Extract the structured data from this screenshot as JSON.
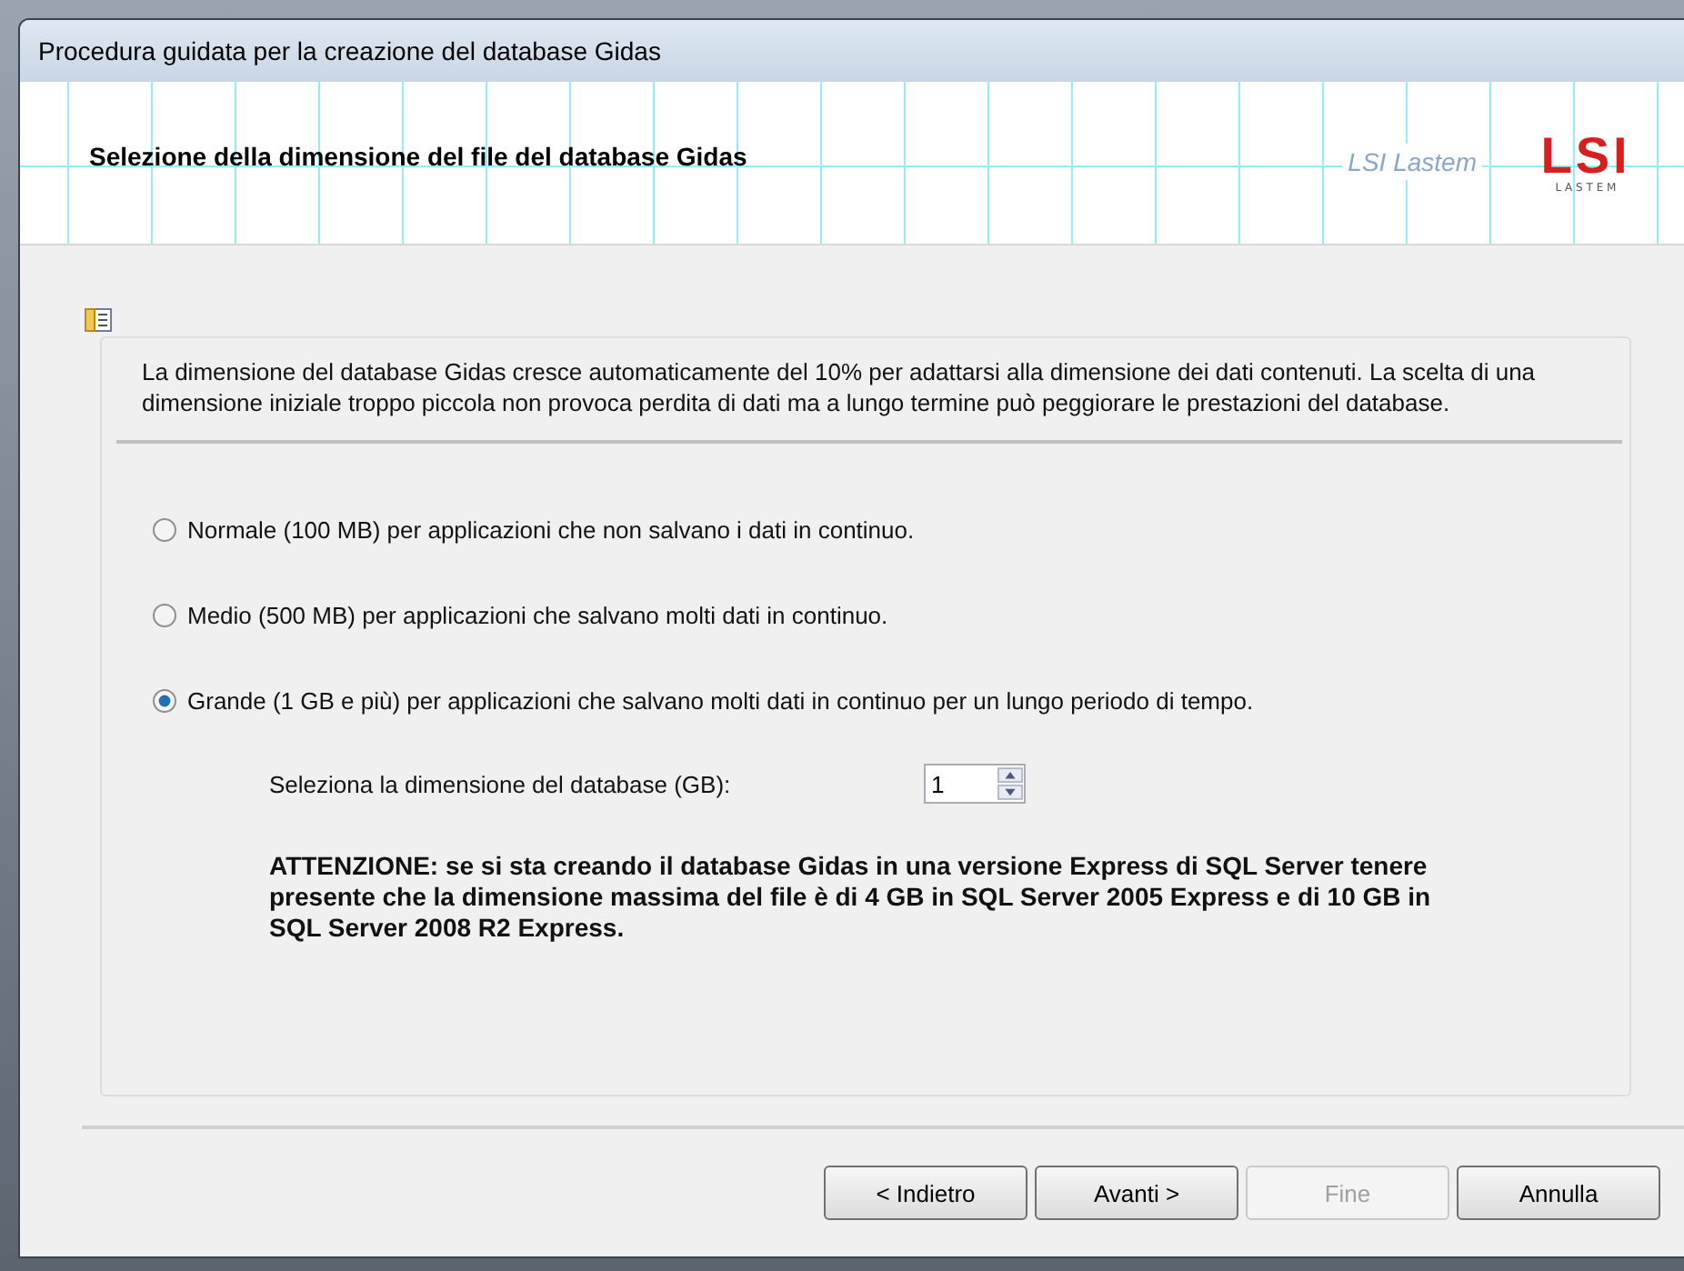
{
  "window": {
    "title": "Procedura guidata per la creazione del database Gidas"
  },
  "header": {
    "title": "Selezione della dimensione del file del database Gidas",
    "brand": "LSI Lastem",
    "logo_mark": "LSI",
    "logo_sub": "L A S T E M"
  },
  "info": "La dimensione del database Gidas cresce automaticamente del 10% per adattarsi alla dimensione dei dati contenuti. La scelta di una dimensione iniziale troppo piccola non provoca perdita di dati ma a lungo termine può peggiorare le prestazioni del database.",
  "options": [
    {
      "label": "Normale (100 MB) per applicazioni che non salvano i dati in continuo.",
      "selected": false
    },
    {
      "label": "Medio (500 MB) per applicazioni che salvano molti dati in continuo.",
      "selected": false
    },
    {
      "label": "Grande (1 GB e più) per applicazioni che salvano molti dati in continuo per un lungo periodo di tempo.",
      "selected": true
    }
  ],
  "size": {
    "label": "Seleziona la dimensione del database (GB):",
    "value": "1"
  },
  "warning": "ATTENZIONE: se si sta creando il database Gidas in una versione Express di SQL Server tenere presente che la dimensione massima del file è di 4 GB in SQL Server 2005 Express e di 10 GB in SQL Server 2008 R2 Express.",
  "buttons": [
    {
      "label": "< Indietro",
      "disabled": false
    },
    {
      "label": "Avanti >",
      "disabled": false
    },
    {
      "label": "Fine",
      "disabled": true
    },
    {
      "label": "Annulla",
      "disabled": false
    }
  ]
}
